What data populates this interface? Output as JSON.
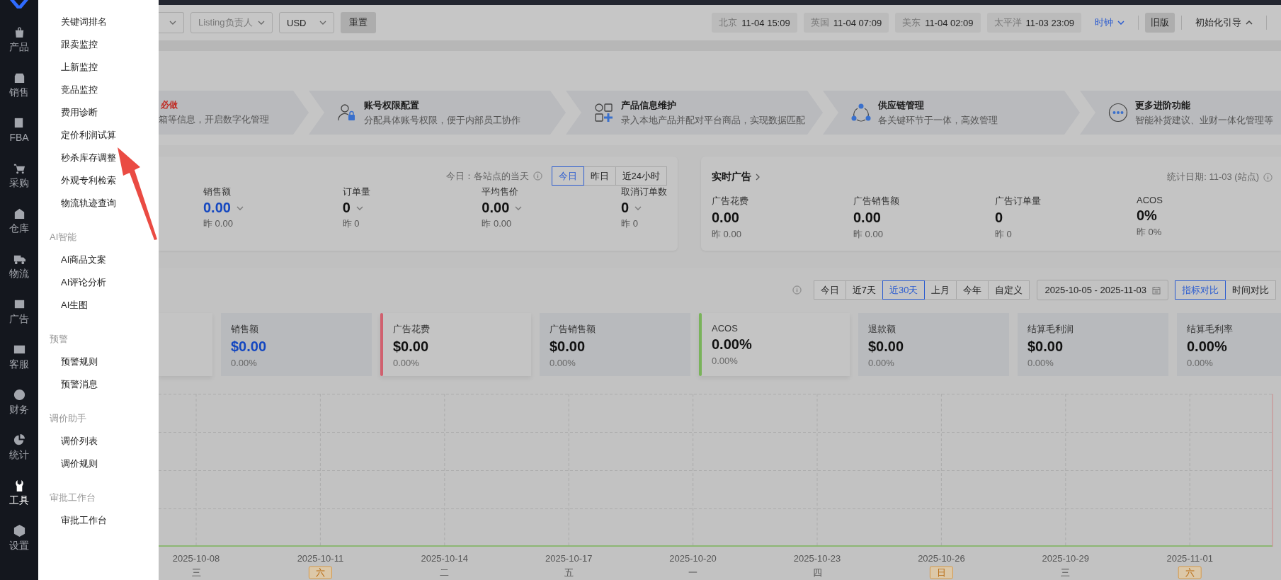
{
  "nav_rail": {
    "items": [
      {
        "label": "产品",
        "selected": false
      },
      {
        "label": "销售",
        "selected": false
      },
      {
        "label": "FBA",
        "selected": false
      },
      {
        "label": "采购",
        "selected": false
      },
      {
        "label": "仓库",
        "selected": false
      },
      {
        "label": "物流",
        "selected": false
      },
      {
        "label": "广告",
        "selected": false
      },
      {
        "label": "客服",
        "selected": false
      },
      {
        "label": "财务",
        "selected": false
      },
      {
        "label": "统计",
        "selected": false
      },
      {
        "label": "工具",
        "selected": true
      },
      {
        "label": "设置",
        "selected": false
      }
    ]
  },
  "tools_menu": {
    "sections": [
      {
        "items": [
          "关键词排名",
          "跟卖监控",
          "上新监控",
          "竞品监控",
          "费用诊断",
          "定价利润试算",
          "秒杀库存调整",
          "外观专利检索",
          "物流轨迹查询"
        ]
      },
      {
        "title": "AI智能",
        "items": [
          "AI商品文案",
          "AI评论分析",
          "AI生图"
        ]
      },
      {
        "title": "预警",
        "items": [
          "预警规则",
          "预警消息"
        ]
      },
      {
        "title": "调价助手",
        "items": [
          "调价列表",
          "调价规则"
        ]
      },
      {
        "title": "审批工作台",
        "items": [
          "审批工作台"
        ]
      }
    ]
  },
  "toolbar": {
    "filters": [
      {
        "placeholder": "Listing负责人"
      },
      {
        "value": "USD"
      }
    ],
    "reset_button": "重置",
    "clocks": [
      {
        "zone": "北京",
        "time": "11-04 15:09"
      },
      {
        "zone": "英国",
        "time": "11-04 07:09"
      },
      {
        "zone": "美东",
        "time": "11-04 02:09"
      },
      {
        "zone": "太平洋",
        "time": "11-03 23:09"
      }
    ],
    "clock_menu": "时钟",
    "old_version_button": "旧版",
    "guide_toggle": "初始化引导"
  },
  "guide_steps": [
    {
      "tag": "必做",
      "description": "箱等信息，开启数字化管理"
    },
    {
      "title": "账号权限配置",
      "description": "分配具体账号权限，便于内部员工协作"
    },
    {
      "title": "产品信息维护",
      "description": "录入本地产品并配对平台商品，实现数据匹配"
    },
    {
      "title": "供应链管理",
      "description": "各关键环节于一体，高效管理"
    },
    {
      "title": "更多进阶功能",
      "description": "智能补货建议、业财一体化管理等"
    }
  ],
  "today_card": {
    "note": "今日：各站点的当天",
    "periods": [
      {
        "label": "今日",
        "selected": true
      },
      {
        "label": "昨日",
        "selected": false
      },
      {
        "label": "近24小时",
        "selected": false
      }
    ],
    "metrics": [
      {
        "label": "销售额",
        "value": "0.00",
        "previous": "昨 0.00",
        "emphasis": true
      },
      {
        "label": "订单量",
        "value": "0",
        "previous": "昨 0",
        "emphasis": false
      },
      {
        "label": "平均售价",
        "value": "0.00",
        "previous": "昨 0.00",
        "emphasis": false
      },
      {
        "label": "取消订单数",
        "value": "0",
        "previous": "昨 0",
        "emphasis": false
      }
    ]
  },
  "ad_card": {
    "title": "实时广告",
    "date": "统计日期: 11-03 (站点)",
    "metrics": [
      {
        "label": "广告花费",
        "value": "0.00",
        "previous": "昨 0.00"
      },
      {
        "label": "广告销售额",
        "value": "0.00",
        "previous": "昨 0.00"
      },
      {
        "label": "广告订单量",
        "value": "0",
        "previous": "昨 0"
      },
      {
        "label": "ACOS",
        "value": "0%",
        "previous": "昨 0%"
      }
    ]
  },
  "trend": {
    "ranges": [
      {
        "label": "今日",
        "selected": false
      },
      {
        "label": "近7天",
        "selected": false
      },
      {
        "label": "近30天",
        "selected": true
      },
      {
        "label": "上月",
        "selected": false
      },
      {
        "label": "今年",
        "selected": false
      },
      {
        "label": "自定义",
        "selected": false
      }
    ],
    "date_range": "2025-10-05 - 2025-11-03",
    "compare_modes": [
      {
        "label": "指标对比",
        "selected": true
      },
      {
        "label": "时间对比",
        "selected": false
      }
    ],
    "kpis": [
      {
        "label": "销售额",
        "value": "$0.00",
        "change": "0.00%",
        "selected": false,
        "emphasis": true
      },
      {
        "label": "广告花费",
        "value": "$0.00",
        "change": "0.00%",
        "selected": true,
        "color": "#d0606e",
        "emphasis": false
      },
      {
        "label": "广告销售额",
        "value": "$0.00",
        "change": "0.00%",
        "selected": false,
        "emphasis": false
      },
      {
        "label": "ACOS",
        "value": "0.00%",
        "change": "0.00%",
        "selected": true,
        "color": "#79b35a",
        "emphasis": false
      },
      {
        "label": "退款额",
        "value": "$0.00",
        "change": "0.00%",
        "selected": false,
        "emphasis": false
      },
      {
        "label": "结算毛利润",
        "value": "$0.00",
        "change": "0.00%",
        "selected": false,
        "emphasis": false
      },
      {
        "label": "结算毛利率",
        "value": "0.00%",
        "change": "0.00%",
        "selected": false,
        "emphasis": false
      }
    ],
    "x_axis": [
      {
        "date": "2025-10-08",
        "weekday": "三",
        "weekend": false
      },
      {
        "date": "2025-10-11",
        "weekday": "六",
        "weekend": true
      },
      {
        "date": "2025-10-14",
        "weekday": "二",
        "weekend": false
      },
      {
        "date": "2025-10-17",
        "weekday": "五",
        "weekend": false
      },
      {
        "date": "2025-10-20",
        "weekday": "一",
        "weekend": false
      },
      {
        "date": "2025-10-23",
        "weekday": "四",
        "weekend": false
      },
      {
        "date": "2025-10-26",
        "weekday": "日",
        "weekend": true
      },
      {
        "date": "2025-10-29",
        "weekday": "三",
        "weekend": false
      },
      {
        "date": "2025-11-01",
        "weekday": "六",
        "weekend": true
      }
    ]
  }
}
